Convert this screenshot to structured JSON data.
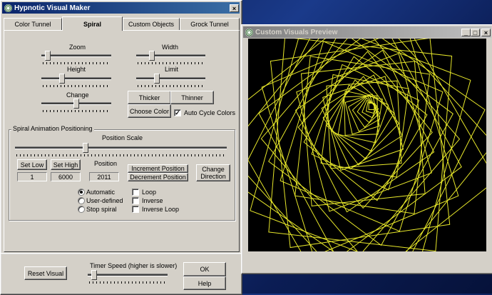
{
  "main_window": {
    "title": "Hypnotic Visual Maker",
    "close_glyph": "×",
    "tabs": [
      {
        "label": "Color Tunnel"
      },
      {
        "label": "Spiral",
        "selected": true
      },
      {
        "label": "Custom Objects"
      },
      {
        "label": "Grock Tunnel"
      }
    ],
    "sliders": {
      "zoom": {
        "label": "Zoom",
        "value": 0.05
      },
      "width": {
        "label": "Width",
        "value": 0.2
      },
      "height": {
        "label": "Height",
        "value": 0.28
      },
      "limit": {
        "label": "Limit",
        "value": 0.28
      },
      "change": {
        "label": "Change",
        "value": 0.5
      }
    },
    "buttons": {
      "thicker": "Thicker",
      "thinner": "Thinner",
      "choose_color": "Choose Color"
    },
    "auto_cycle": {
      "label": "Auto Cycle Colors",
      "checked": true,
      "glyph": "✓"
    },
    "group": {
      "title": "Spiral Animation Positioning",
      "position_scale": {
        "label": "Position Scale",
        "value": 0.33
      },
      "set_low": {
        "label": "Set Low",
        "value": "1"
      },
      "set_high": {
        "label": "Set High",
        "value": "6000"
      },
      "position": {
        "label": "Position",
        "value": "2011"
      },
      "increment": "Increment Position",
      "decrement": "Decrement Position",
      "change_direction": "Change Direction",
      "radios": [
        {
          "label": "Automatic",
          "selected": true
        },
        {
          "label": "User-defined",
          "selected": false
        },
        {
          "label": "Stop spiral",
          "selected": false
        }
      ],
      "checks": [
        {
          "label": "Loop",
          "checked": false
        },
        {
          "label": "Inverse",
          "checked": false
        },
        {
          "label": "Inverse Loop",
          "checked": false
        }
      ]
    },
    "footer": {
      "reset_visual": "Reset Visual",
      "timer_label": "Timer Speed (higher is slower)",
      "timer_value": 0.05,
      "ok": "OK",
      "help": "Help"
    }
  },
  "preview_window": {
    "title": "Custom Visuals Preview",
    "minimize_glyph": "_",
    "maximize_glyph": "□",
    "close_glyph": "×",
    "line_color": "#e6e62a",
    "background_color": "#000000"
  }
}
